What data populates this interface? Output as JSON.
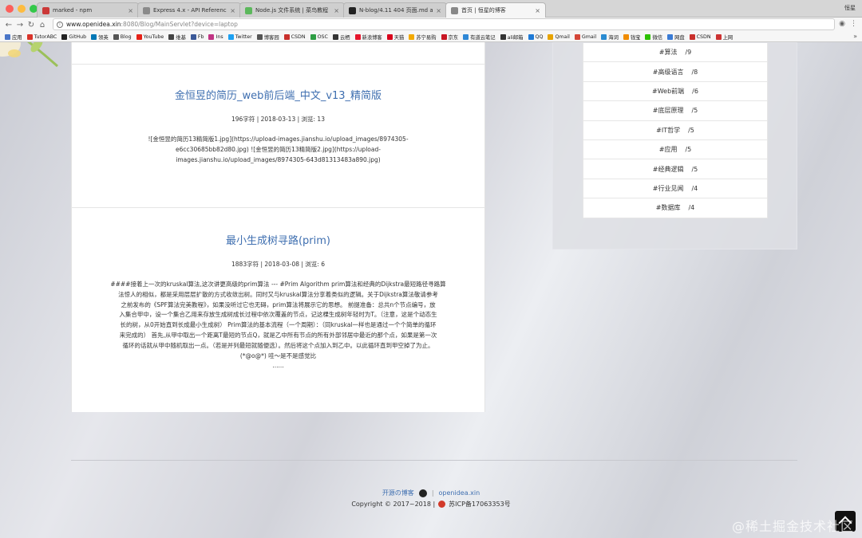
{
  "browser": {
    "tabs": [
      {
        "label": "marked - npm",
        "icon_color": "#cb3837",
        "active": false
      },
      {
        "label": "Express 4.x - API Reference",
        "icon_color": "#8a8a8a",
        "active": false
      },
      {
        "label": "Node.js 文件系统 | 菜鸟教程",
        "icon_color": "#5cb85c",
        "active": false
      },
      {
        "label": "N-blog/4.11 404 页面.md at m...",
        "icon_color": "#222222",
        "active": false
      },
      {
        "label": "首页 | 恒星的博客",
        "icon_color": "#888888",
        "active": true
      }
    ],
    "user": "恒星",
    "address": {
      "host": "www.openidea.xin",
      "path": ":8080/Blog/MainServlet?device=laptop"
    },
    "bookmarks": [
      {
        "label": "应用",
        "color": "#4a76c8"
      },
      {
        "label": "TutorABC",
        "color": "#d9342b"
      },
      {
        "label": "GitHub",
        "color": "#222222"
      },
      {
        "label": "领英",
        "color": "#0077b5"
      },
      {
        "label": "Blog",
        "color": "#555555"
      },
      {
        "label": "YouTube",
        "color": "#e62117"
      },
      {
        "label": "维基",
        "color": "#444444"
      },
      {
        "label": "Fb",
        "color": "#3b5998"
      },
      {
        "label": "Ins",
        "color": "#c13584"
      },
      {
        "label": "Twitter",
        "color": "#1da1f2"
      },
      {
        "label": "博客园",
        "color": "#555555"
      },
      {
        "label": "CSDN",
        "color": "#c9302c"
      },
      {
        "label": "OSC",
        "color": "#2e9e44"
      },
      {
        "label": "云栖",
        "color": "#333333"
      },
      {
        "label": "新浪博客",
        "color": "#e6162d"
      },
      {
        "label": "天猫",
        "color": "#d9001b"
      },
      {
        "label": "苏宁易购",
        "color": "#f2a900"
      },
      {
        "label": "京东",
        "color": "#c81623"
      },
      {
        "label": "有道云笔记",
        "color": "#2f88d6"
      },
      {
        "label": "ali邮箱",
        "color": "#333333"
      },
      {
        "label": "QQ",
        "color": "#1f7ad6"
      },
      {
        "label": "Qmail",
        "color": "#e8a400"
      },
      {
        "label": "Gmail",
        "color": "#d44638"
      },
      {
        "label": "海词",
        "color": "#2a8bd1"
      },
      {
        "label": "钱宝",
        "color": "#f08c00"
      },
      {
        "label": "微信",
        "color": "#2dc100"
      },
      {
        "label": "网盘",
        "color": "#3a7bd5"
      },
      {
        "label": "CSDN",
        "color": "#c9302c"
      },
      {
        "label": "上网",
        "color": "#cc3333"
      }
    ]
  },
  "posts": [
    {
      "title": "金恒昱的简历_web前后端_中文_v13_精简版",
      "meta": "196字符  |  2018-03-13  |  浏览: 13",
      "body": [
        "![金恒昱的简历13精简版1.jpg](https://upload-images.jianshu.io/upload_images/8974305-",
        "e6cc30685bb82d80.jpg) ![金恒昱的简历13精简版2.jpg](https://upload-",
        "images.jianshu.io/upload_images/8974305-643d81313483a890.jpg)"
      ]
    },
    {
      "title": "最小生成树寻路(prim)",
      "meta": "1883字符  |  2018-03-08  |  浏览: 6",
      "body": [
        "####接着上一次的kruskal算法,这次讲更高级的prim算法 --- #Prim Algorithm prim算法和经典的Dijkstra最短路径寻路算",
        "法惊人的相似，都是采用层层扩散的方式收敛出树。同时又与kruskal算法分享着类似的逻辑。关于Dijkstra算法敬请参考",
        "之前发布的《SPF算法完美教程》，如果没听过它也无碍，prim算法将展示它的思想。 前提准备：总共n个节点编号，放",
        "入集合甲中，设一个集合乙用来存放生成树成长过程中依次覆盖的节点，记这棵生成树年轻时为T。（注意，这是个动态生",
        "长的树，从0开始直到长成最小生成树） Prim算法的基本流程（一个周期）：（同kruskal一样也是通过一个个简单的循环",
        "来完成的） 首先,从甲中取出一个距离T最短的节点Q，就是乙中所有节点的所有外部邻居中最近的那个点，如果是第一次",
        "循环的话就从甲中随机取出一点。（若是并列最短就随便选）。然后将这个点加入到乙中。以此循环直到甲空掉了为止。",
        "(*@o@*) 哇～是不是感觉比",
        "......"
      ]
    }
  ],
  "tags": [
    {
      "name": "#算法",
      "count": "/9"
    },
    {
      "name": "#高级语言",
      "count": "/8"
    },
    {
      "name": "#Web前端",
      "count": "/6"
    },
    {
      "name": "#底层原理",
      "count": "/5"
    },
    {
      "name": "#IT哲学",
      "count": "/5"
    },
    {
      "name": "#应用",
      "count": "/5"
    },
    {
      "name": "#经典逻辑",
      "count": "/5"
    },
    {
      "name": "#行业见闻",
      "count": "/4"
    },
    {
      "name": "#数据库",
      "count": "/4"
    }
  ],
  "footer": {
    "repo_link": "开源の博客",
    "site_link": "openidea.xin",
    "copyright": "Copyright © 2017~2018 |",
    "icp": "苏ICP备17063353号"
  },
  "watermark": "@稀土掘金技术社区"
}
